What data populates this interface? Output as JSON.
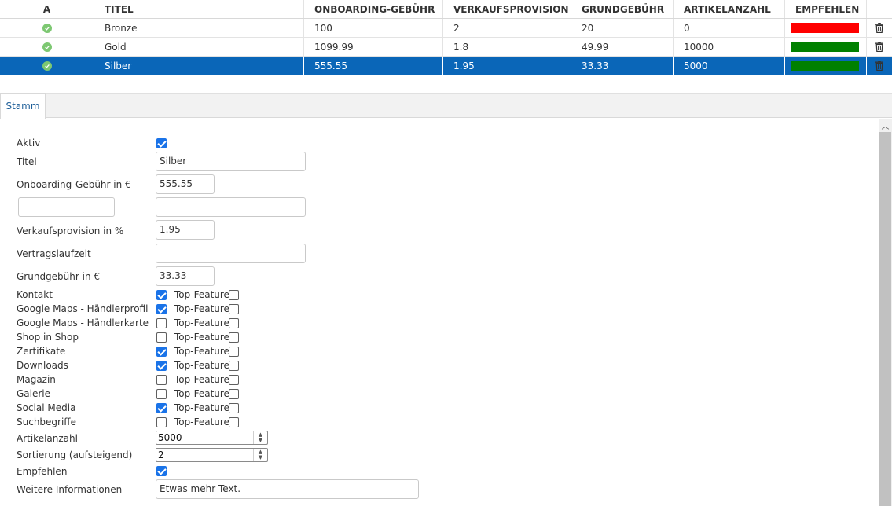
{
  "grid": {
    "columns": [
      "A",
      "TITEL",
      "ONBOARDING-GEBÜHR",
      "VERKAUFSPROVISION",
      "GRUNDGEBÜHR",
      "ARTIKELANZAHL",
      "EMPFEHLEN"
    ],
    "rows": [
      {
        "title": "Bronze",
        "onboarding": "100",
        "provision": "2",
        "grund": "20",
        "artikel": "0",
        "empfehlen_color": "#ff0000"
      },
      {
        "title": "Gold",
        "onboarding": "1099.99",
        "provision": "1.8",
        "grund": "49.99",
        "artikel": "10000",
        "empfehlen_color": "#008000"
      },
      {
        "title": "Silber",
        "onboarding": "555.55",
        "provision": "1.95",
        "grund": "33.33",
        "artikel": "5000",
        "empfehlen_color": "#008000"
      }
    ],
    "selected_color": "#0a66b8"
  },
  "tabs": [
    {
      "label": "Stamm"
    }
  ],
  "form": {
    "aktiv_label": "Aktiv",
    "titel_label": "Titel",
    "titel_value": "Silber",
    "onboarding_label": "Onboarding-Gebühr in €",
    "onboarding_value": "555.55",
    "extra_label_value": "",
    "extra_value": "",
    "verkauf_label": "Verkaufsprovision in %",
    "verkauf_value": "1.95",
    "vertrag_label": "Vertragslaufzeit",
    "vertrag_value": "",
    "grund_label": "Grundgebühr in €",
    "grund_value": "33.33",
    "top_feature_label": "Top-Feature",
    "features": [
      {
        "label": "Kontakt",
        "checked": true,
        "top": false
      },
      {
        "label": "Google Maps - Händlerprofil",
        "checked": true,
        "top": false
      },
      {
        "label": "Google Maps - Händlerkarte",
        "checked": false,
        "top": false
      },
      {
        "label": "Shop in Shop",
        "checked": false,
        "top": false
      },
      {
        "label": "Zertifikate",
        "checked": true,
        "top": false
      },
      {
        "label": "Downloads",
        "checked": true,
        "top": false
      },
      {
        "label": "Magazin",
        "checked": false,
        "top": false
      },
      {
        "label": "Galerie",
        "checked": false,
        "top": false
      },
      {
        "label": "Social Media",
        "checked": true,
        "top": false
      },
      {
        "label": "Suchbegriffe",
        "checked": false,
        "top": false
      }
    ],
    "artikel_label": "Artikelanzahl",
    "artikel_value": "5000",
    "sort_label": "Sortierung (aufsteigend)",
    "sort_value": "2",
    "empfehlen_label": "Empfehlen",
    "empfehlen_checked": true,
    "info_label": "Weitere Informationen",
    "info_value": "Etwas mehr Text."
  }
}
